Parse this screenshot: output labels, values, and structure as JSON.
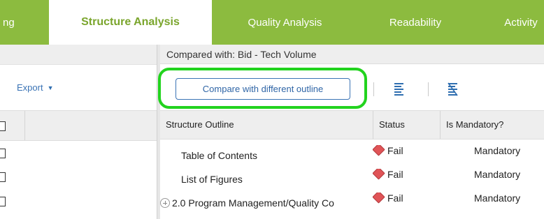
{
  "tabs": [
    {
      "label": "ng",
      "active": false
    },
    {
      "label": "Structure Analysis",
      "active": true
    },
    {
      "label": "Quality Analysis",
      "active": false
    },
    {
      "label": "Readability",
      "active": false
    },
    {
      "label": "Activity",
      "active": false
    }
  ],
  "left_panel": {
    "export_label": "Export",
    "row_checkbox_count": 3
  },
  "right_panel": {
    "compared_with": "Compared with: Bid - Tech Volume",
    "compare_button_label": "Compare with different outline",
    "toolbar_icons": [
      "align-lines-icon",
      "clear-format-icon"
    ]
  },
  "grid": {
    "columns": [
      "Structure Outline",
      "Status",
      "Is Mandatory?"
    ],
    "rows": [
      {
        "outline": "Table of Contents",
        "status": "Fail",
        "mandatory": "Mandatory",
        "expandable": false
      },
      {
        "outline": "List of Figures",
        "status": "Fail",
        "mandatory": "Mandatory",
        "expandable": false
      },
      {
        "outline": "2.0 Program Management/Quality Co",
        "status": "Fail",
        "mandatory": "Mandatory",
        "expandable": true
      }
    ]
  },
  "colors": {
    "tab_bar": "#8cbb3f",
    "active_tab_text": "#7aa52c",
    "highlight_ring": "#22d31e",
    "link_blue": "#3a73b5",
    "fail_red": "#e05457"
  }
}
